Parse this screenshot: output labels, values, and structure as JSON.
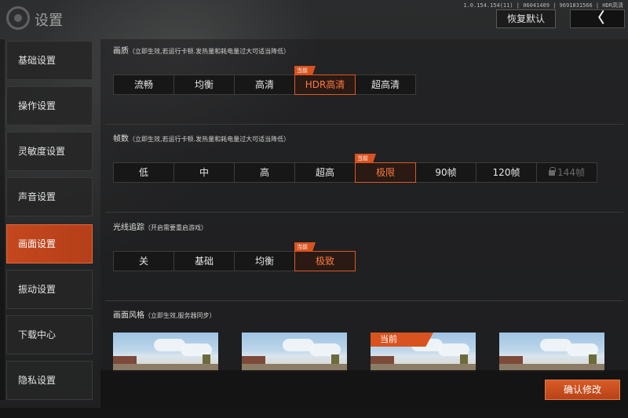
{
  "header": {
    "title": "设置",
    "version": "1.0.154.154(11) | 06041409 | 9691831566 | HDR高清",
    "restore_label": "恢复默认",
    "back_label": "〈"
  },
  "sidebar": {
    "items": [
      {
        "label": "基础设置"
      },
      {
        "label": "操作设置"
      },
      {
        "label": "灵敏度设置"
      },
      {
        "label": "声音设置"
      },
      {
        "label": "画面设置",
        "active": true
      },
      {
        "label": "振动设置"
      },
      {
        "label": "下载中心"
      },
      {
        "label": "隐私设置"
      }
    ]
  },
  "sections": {
    "quality": {
      "title": "画质",
      "note": "（立即生效,若运行卡顿.发热量和耗电量过大可适当降低）",
      "options": [
        "流畅",
        "均衡",
        "高清",
        "HDR高清",
        "超高清"
      ],
      "selected": "HDR高清",
      "current_tag": "当前"
    },
    "fps": {
      "title": "帧数",
      "note": "（立即生效,若运行卡顿.发热量和耗电量过大可适当降低）",
      "options": [
        "低",
        "中",
        "高",
        "超高",
        "极限",
        "90帧",
        "120帧",
        "144帧"
      ],
      "selected": "极限",
      "locked": "144帧",
      "current_tag": "当前"
    },
    "raytracing": {
      "title": "光线追踪",
      "note": "（开启需要重启游戏）",
      "options": [
        "关",
        "基础",
        "均衡",
        "极致"
      ],
      "selected": "极致",
      "current_tag": "当前"
    },
    "style": {
      "title": "画面风格",
      "note": "（立即生效,服务器同步）",
      "current_tag": "当前"
    }
  },
  "footer": {
    "confirm_label": "确认修改"
  },
  "colors": {
    "accent": "#d8531f",
    "selected_text": "#ff7a3f",
    "background": "#232425"
  }
}
